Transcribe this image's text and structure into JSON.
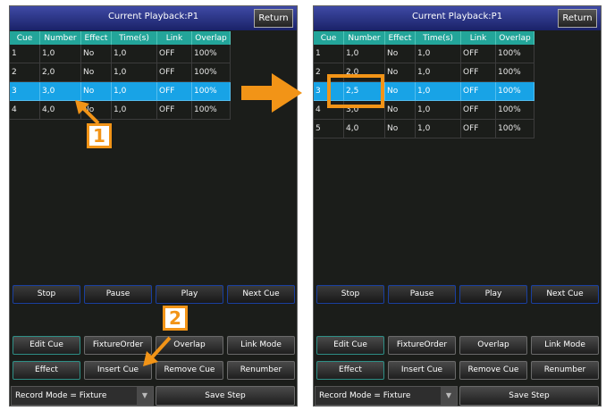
{
  "colors": {
    "accent": "#f29417",
    "header": "#23a59a",
    "selected_row": "#18a3e6",
    "title_bar": "#2a338a"
  },
  "annotations": {
    "badge_1": "1",
    "badge_2": "2",
    "arrow_icon": "right-arrow"
  },
  "columns": [
    "Cue",
    "Number",
    "Effect",
    "Time(s)",
    "Link",
    "Overlap"
  ],
  "left": {
    "title": "Current Playback:P1",
    "return": "Return",
    "rows": [
      [
        "1",
        "1,0",
        "No",
        "1,0",
        "OFF",
        "100%"
      ],
      [
        "2",
        "2,0",
        "No",
        "1,0",
        "OFF",
        "100%"
      ],
      [
        "3",
        "3,0",
        "No",
        "1,0",
        "OFF",
        "100%"
      ],
      [
        "4",
        "4,0",
        "No",
        "1,0",
        "OFF",
        "100%"
      ]
    ],
    "selected_row": 3,
    "transport": [
      "Stop",
      "Pause",
      "Play",
      "Next Cue"
    ],
    "row1": [
      "Edit Cue",
      "FixtureOrder",
      "Overlap",
      "Link Mode"
    ],
    "row2": [
      "Effect",
      "Insert Cue",
      "Remove Cue",
      "Renumber"
    ],
    "record_mode": "Record Mode = Fixture",
    "save_step": "Save Step"
  },
  "right": {
    "title": "Current Playback:P1",
    "return": "Return",
    "rows": [
      [
        "1",
        "1,0",
        "No",
        "1,0",
        "OFF",
        "100%"
      ],
      [
        "2",
        "2,0",
        "No",
        "1,0",
        "OFF",
        "100%"
      ],
      [
        "3",
        "2,5",
        "No",
        "1,0",
        "OFF",
        "100%"
      ],
      [
        "4",
        "3,0",
        "No",
        "1,0",
        "OFF",
        "100%"
      ],
      [
        "5",
        "4,0",
        "No",
        "1,0",
        "OFF",
        "100%"
      ]
    ],
    "selected_row": 3,
    "transport": [
      "Stop",
      "Pause",
      "Play",
      "Next Cue"
    ],
    "row1": [
      "Edit Cue",
      "FixtureOrder",
      "Overlap",
      "Link Mode"
    ],
    "row2": [
      "Effect",
      "Insert Cue",
      "Remove Cue",
      "Renumber"
    ],
    "record_mode": "Record Mode = Fixture",
    "save_step": "Save Step"
  }
}
